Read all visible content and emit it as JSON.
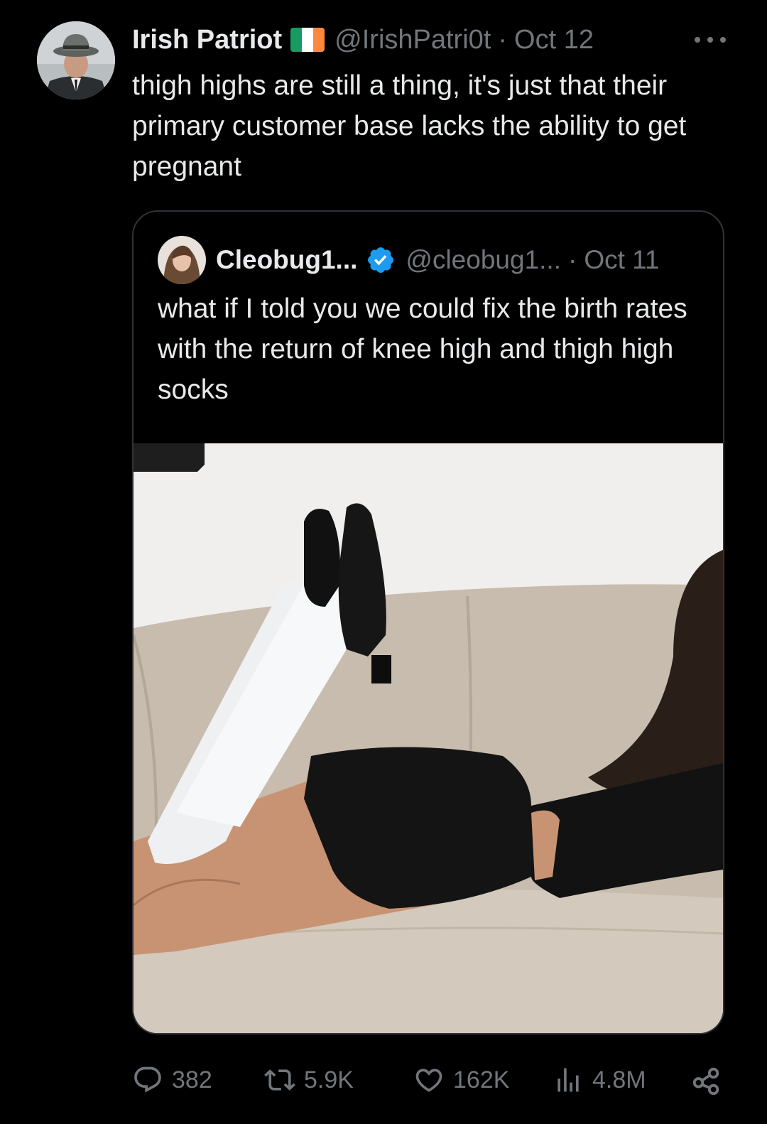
{
  "tweet": {
    "display_name": "Irish Patriot",
    "flag_icon": "ireland-flag-icon",
    "flag_colors": [
      "#169b62",
      "#ffffff",
      "#ff883e"
    ],
    "handle": "@IrishPatri0t",
    "separator": "·",
    "date": "Oct 12",
    "text": "thigh highs are still a thing, it's just that their primary customer base lacks the ability to get pregnant",
    "more_icon": "more-horizontal-icon"
  },
  "quote": {
    "display_name": "Cleobug1...",
    "verified_icon": "verified-badge-icon",
    "verified_color": "#1d9bf0",
    "handle": "@cleobug1...",
    "separator": "·",
    "date": "Oct 11",
    "text": "what if I told you we could fix the birth rates with the return of knee high and thigh high socks"
  },
  "actions": {
    "replies": {
      "icon": "reply-icon",
      "count": "382"
    },
    "reposts": {
      "icon": "repost-icon",
      "count": "5.9K"
    },
    "likes": {
      "icon": "heart-icon",
      "count": "162K"
    },
    "views": {
      "icon": "views-bar-chart-icon",
      "count": "4.8M"
    },
    "share": {
      "icon": "share-icon"
    }
  },
  "colors": {
    "background": "#000000",
    "primary_text": "#e7e9ea",
    "secondary_text": "#71767b",
    "border": "#2f3336"
  }
}
